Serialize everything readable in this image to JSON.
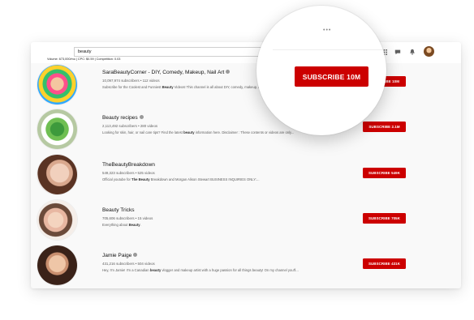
{
  "search": {
    "query": "beauty"
  },
  "keyword_stats": "Volume: 673,000/mo | CPC: $0.59 | Competition: 0.03",
  "channels": [
    {
      "name": "SaraBeautyCorner - DIY, Comedy, Makeup, Nail Art",
      "meta": "10,097,974 subscribers • 112 videos",
      "desc_pre": "Subscribe for the Coolest and Funniest ",
      "desc_bold": "Beauty",
      "desc_post": " Videos! This channel is all about DIY, comedy, makeup, nail art, hair...",
      "subscribe": "SUBSCRIBE  10M"
    },
    {
      "name": "Beauty recipes",
      "meta": "2,113,492 subscribers • 280 videos",
      "desc_pre": "Looking for skin, hair, or nail care tips? Find the latest ",
      "desc_bold": "beauty",
      "desc_post": " information here. Disclaimer : These contents or videos are only...",
      "subscribe": "SUBSCRIBE  2.1M"
    },
    {
      "name": "TheBeautyBreakdown",
      "meta": "549,323 subscribers • 525 videos",
      "desc_pre": "Official youtube for ",
      "desc_bold": "The Beauty",
      "desc_post": " Breakdown and Morgan Alison Stewart BUSINESS INQUIRIES ONLY:...",
      "subscribe": "SUBSCRIBE  549K"
    },
    {
      "name": "Beauty Tricks",
      "meta": "705,606 subscribers • 15 videos",
      "desc_pre": "Everything about ",
      "desc_bold": "Beauty",
      "desc_post": ".",
      "subscribe": "SUBSCRIBE  705K"
    },
    {
      "name": "Jamie Paige",
      "meta": "431,216 subscribers • 504 videos",
      "desc_pre": "Hey, I'm Jamie! I'm a Canadian ",
      "desc_bold": "beauty",
      "desc_post": " vlogger and makeup artist with a huge passion for all things beauty! On my channel you'll...",
      "subscribe": "SUBSCRIBE  431K"
    }
  ],
  "magnifier": {
    "subscribe_label": "SUBSCRIBE  10M",
    "dots": "•••"
  },
  "colors": {
    "subscribe": "#cc0000",
    "background": "#f9f9f9"
  },
  "icons": [
    "search-icon",
    "apps-grid-icon",
    "messages-icon",
    "bell-icon",
    "verified-icon"
  ]
}
